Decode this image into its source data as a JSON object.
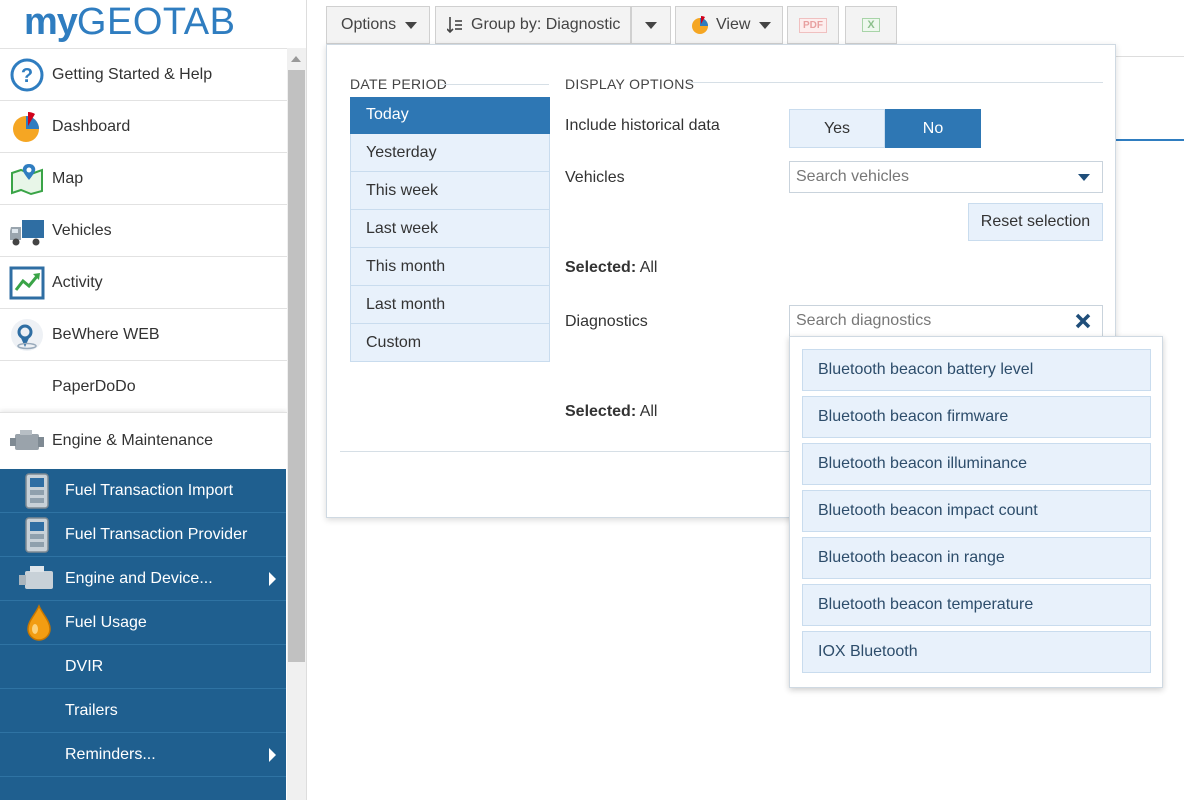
{
  "app": {
    "logo_my": "my",
    "logo_geotab": "GEOTAB"
  },
  "sidebar": {
    "items": [
      {
        "label": "Getting Started & Help",
        "icon": "help-icon"
      },
      {
        "label": "Dashboard",
        "icon": "dashboard-pie-icon"
      },
      {
        "label": "Map",
        "icon": "map-icon"
      },
      {
        "label": "Vehicles",
        "icon": "truck-icon"
      },
      {
        "label": "Activity",
        "icon": "activity-chart-icon"
      },
      {
        "label": "BeWhere WEB",
        "icon": "bewhere-pin-icon"
      },
      {
        "label": "PaperDoDo",
        "icon": ""
      },
      {
        "label": "Engine & Maintenance",
        "icon": "engine-icon"
      }
    ],
    "subitems": [
      {
        "label": "Fuel Transaction Import",
        "icon": "fuel-pump-icon",
        "has_arrow": false
      },
      {
        "label": "Fuel Transaction Provider",
        "icon": "fuel-pump-icon",
        "has_arrow": false
      },
      {
        "label": "Engine and Device...",
        "icon": "engine-icon",
        "has_arrow": true
      },
      {
        "label": "Fuel Usage",
        "icon": "fuel-drop-icon",
        "has_arrow": false
      },
      {
        "label": "DVIR",
        "icon": "",
        "has_arrow": false
      },
      {
        "label": "Trailers",
        "icon": "",
        "has_arrow": false
      },
      {
        "label": "Reminders...",
        "icon": "",
        "has_arrow": true
      }
    ]
  },
  "toolbar": {
    "options_label": "Options",
    "groupby_label": "Group by: Diagnostic",
    "view_label": "View",
    "pdf_label": "PDF",
    "excel_label": "X"
  },
  "panel": {
    "date_period_title": "DATE PERIOD",
    "display_options_title": "DISPLAY OPTIONS",
    "periods": [
      "Today",
      "Yesterday",
      "This week",
      "Last week",
      "This month",
      "Last month",
      "Custom"
    ],
    "active_period": "Today",
    "historical_label": "Include historical data",
    "yes_label": "Yes",
    "no_label": "No",
    "historical_value": "No",
    "vehicles_label": "Vehicles",
    "vehicles_placeholder": "Search vehicles",
    "reset_label": "Reset selection",
    "selected_prefix": "Selected:",
    "vehicles_selected": "All",
    "diagnostics_label": "Diagnostics",
    "diagnostics_placeholder": "Search diagnostics",
    "diagnostics_selected": "All"
  },
  "diagnostics_dropdown": {
    "options": [
      "Bluetooth beacon battery level",
      "Bluetooth beacon firmware",
      "Bluetooth beacon illuminance",
      "Bluetooth beacon impact count",
      "Bluetooth beacon in range",
      "Bluetooth beacon temperature",
      "IOX Bluetooth"
    ]
  },
  "colors": {
    "brand": "#2f7dc0",
    "accent": "#2e77b4",
    "subnav": "#1f5f8f",
    "option_bg": "#e8f1fb"
  }
}
